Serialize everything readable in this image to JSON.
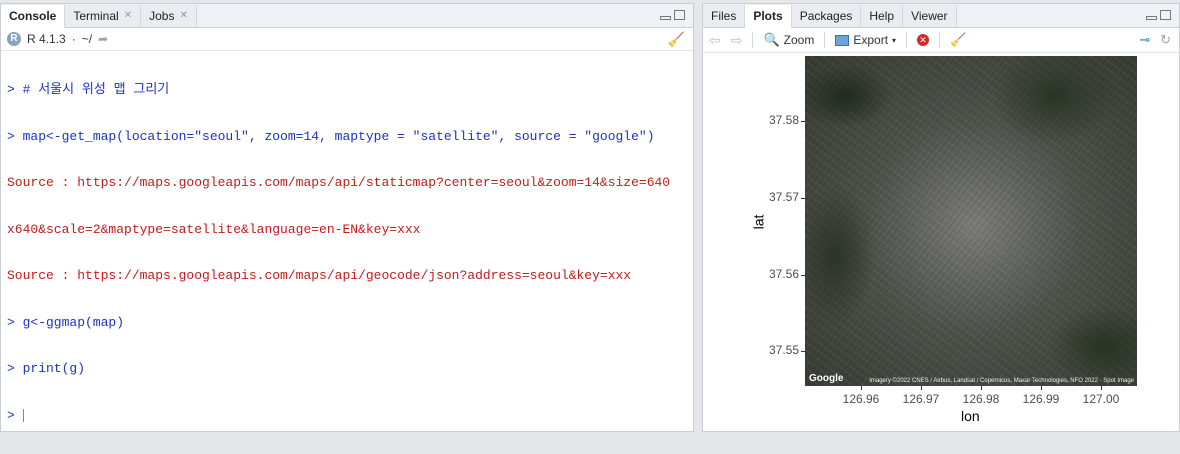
{
  "left": {
    "tabs": [
      {
        "label": "Console",
        "active": true,
        "closable": false
      },
      {
        "label": "Terminal",
        "active": false,
        "closable": true
      },
      {
        "label": "Jobs",
        "active": false,
        "closable": true
      }
    ],
    "console_bar": {
      "r_version": "R 4.1.3",
      "sep": "·",
      "path": "~/"
    },
    "lines": [
      {
        "type": "cmd",
        "text": "> # 서울시 위성 맵 그리기"
      },
      {
        "type": "cmd",
        "text": "> map<-get_map(location=\"seoul\", zoom=14, maptype = \"satellite\", source = \"google\")"
      },
      {
        "type": "out",
        "text": "Source : https://maps.googleapis.com/maps/api/staticmap?center=seoul&zoom=14&size=640"
      },
      {
        "type": "out",
        "text": "x640&scale=2&maptype=satellite&language=en-EN&key=xxx"
      },
      {
        "type": "out",
        "text": "Source : https://maps.googleapis.com/maps/api/geocode/json?address=seoul&key=xxx"
      },
      {
        "type": "cmd",
        "text": "> g<-ggmap(map)"
      },
      {
        "type": "cmd",
        "text": "> print(g)"
      },
      {
        "type": "cmd",
        "text": "> "
      }
    ]
  },
  "right": {
    "tabs": [
      {
        "label": "Files",
        "active": false
      },
      {
        "label": "Plots",
        "active": true
      },
      {
        "label": "Packages",
        "active": false
      },
      {
        "label": "Help",
        "active": false
      },
      {
        "label": "Viewer",
        "active": false
      }
    ],
    "toolbar": {
      "zoom": "Zoom",
      "export": "Export"
    },
    "plot": {
      "xlabel": "lon",
      "ylabel": "lat",
      "xticks": [
        "126.96",
        "126.97",
        "126.98",
        "126.99",
        "127.00"
      ],
      "yticks": [
        "37.58",
        "37.57",
        "37.56",
        "37.55"
      ],
      "map_watermark": "Google",
      "map_attribution": "Imagery ©2022 CNES / Airbus, Landsat / Copernicus, Maxar Technologies, NFO 2022 · Spot Image"
    }
  }
}
